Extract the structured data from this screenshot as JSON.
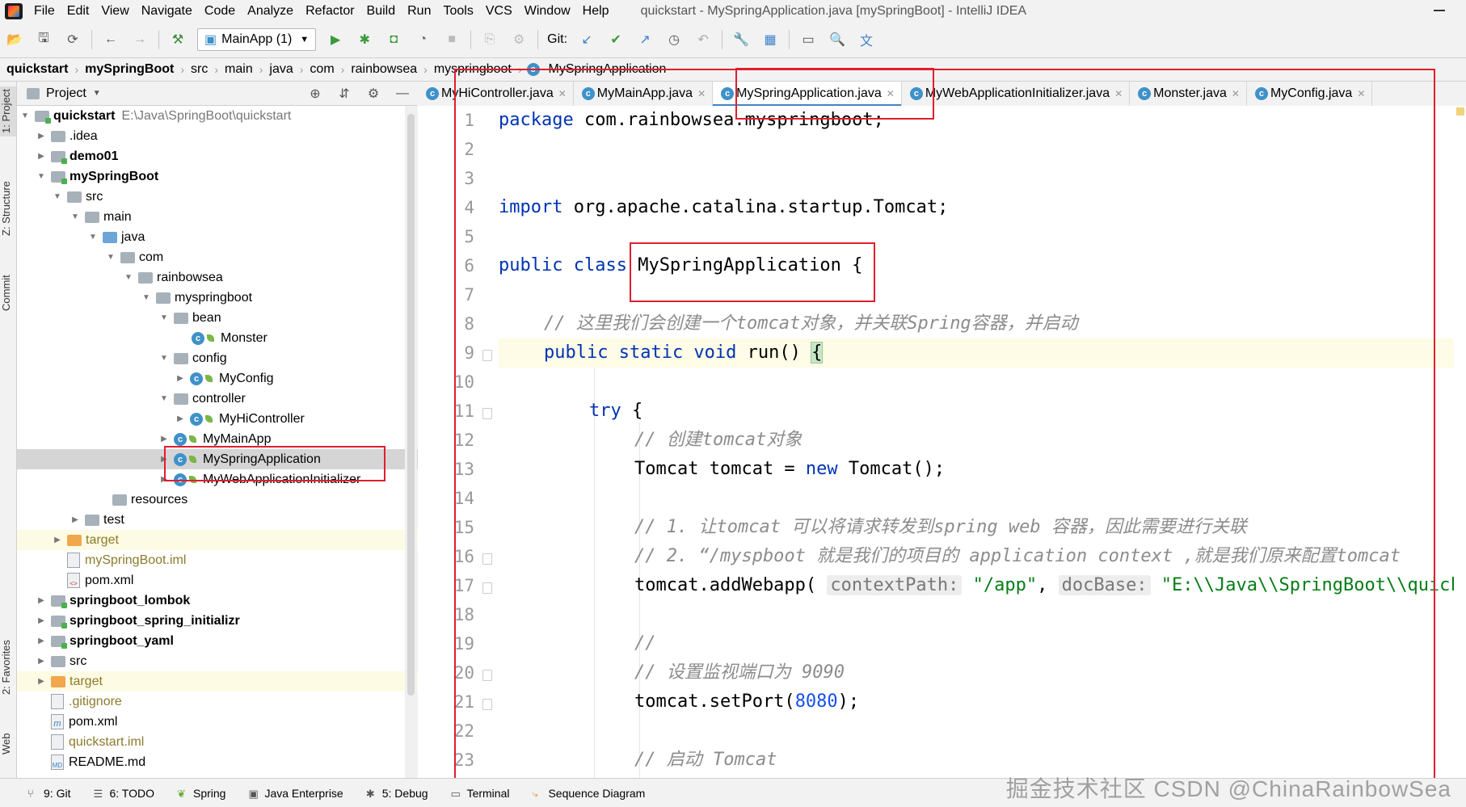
{
  "menu": {
    "items": [
      "File",
      "Edit",
      "View",
      "Navigate",
      "Code",
      "Analyze",
      "Refactor",
      "Build",
      "Run",
      "Tools",
      "VCS",
      "Window",
      "Help"
    ],
    "window_title": "quickstart - MySpringApplication.java [mySpringBoot] - IntelliJ IDEA"
  },
  "toolbar": {
    "run_config": "MainApp (1)",
    "git_label": "Git:"
  },
  "breadcrumb": [
    "quickstart",
    "mySpringBoot",
    "src",
    "main",
    "java",
    "com",
    "rainbowsea",
    "myspringboot",
    "MySpringApplication"
  ],
  "project_panel": {
    "title": "Project",
    "tree": [
      {
        "label": "quickstart",
        "path": "E:\\Java\\SpringBoot\\quickstart"
      },
      {
        "label": ".idea"
      },
      {
        "label": "demo01"
      },
      {
        "label": "mySpringBoot"
      },
      {
        "label": "src"
      },
      {
        "label": "main"
      },
      {
        "label": "java"
      },
      {
        "label": "com"
      },
      {
        "label": "rainbowsea"
      },
      {
        "label": "myspringboot"
      },
      {
        "label": "bean"
      },
      {
        "label": "Monster"
      },
      {
        "label": "config"
      },
      {
        "label": "MyConfig"
      },
      {
        "label": "controller"
      },
      {
        "label": "MyHiController"
      },
      {
        "label": "MyMainApp"
      },
      {
        "label": "MySpringApplication"
      },
      {
        "label": "MyWebApplicationInitializer"
      },
      {
        "label": "resources"
      },
      {
        "label": "test"
      },
      {
        "label": "target"
      },
      {
        "label": "mySpringBoot.iml"
      },
      {
        "label": "pom.xml"
      },
      {
        "label": "springboot_lombok"
      },
      {
        "label": "springboot_spring_initializr"
      },
      {
        "label": "springboot_yaml"
      },
      {
        "label": "src"
      },
      {
        "label": "target"
      },
      {
        "label": ".gitignore"
      },
      {
        "label": "pom.xml"
      },
      {
        "label": "quickstart.iml"
      },
      {
        "label": "README.md"
      }
    ]
  },
  "left_stripe": [
    "1: Project",
    "Z: Structure",
    "Commit",
    "2: Favorites",
    "Web"
  ],
  "editor_tabs": [
    "MyHiController.java",
    "MyMainApp.java",
    "MySpringApplication.java",
    "MyWebApplicationInitializer.java",
    "Monster.java",
    "MyConfig.java"
  ],
  "editor": {
    "line_numbers": [
      "1",
      "2",
      "3",
      "4",
      "5",
      "6",
      "7",
      "8",
      "9",
      "10",
      "11",
      "12",
      "13",
      "14",
      "15",
      "16",
      "17",
      "18",
      "19",
      "20",
      "21",
      "22",
      "23"
    ],
    "code": {
      "l1_kw": "package",
      "l1_rest": " com.rainbowsea.myspringboot;",
      "l4_kw": "import",
      "l4_rest": " org.apache.catalina.startup.Tomcat;",
      "l6_kw": "public class",
      "l6_name": " MySpringApplication ",
      "l6_brace": "{",
      "l8_comment": "// 这里我们会创建一个tomcat对象，并关联Spring容器，并启动",
      "l9_kw": "public static void",
      "l9_rest": " run() ",
      "l9_brace": "{",
      "l11_kw": "try",
      "l11_rest": " {",
      "l12_comment": "// 创建tomcat对象",
      "l13_a": "Tomcat tomcat = ",
      "l13_kw": "new",
      "l13_b": " Tomcat();",
      "l15_comment": "// 1. 让tomcat 可以将请求转发到spring web 容器，因此需要进行关联",
      "l16_comment": "// 2. “/myspboot 就是我们的项目的 application context ,就是我们原来配置tomcat",
      "l17_a": "tomcat.addWebapp( ",
      "l17_hint1": "contextPath:",
      "l17_str1": " \"/app\"",
      "l17_comma": ", ",
      "l17_hint2": "docBase:",
      "l17_str2": " \"E:\\\\Java\\\\SpringBoot\\\\quickst",
      "l19_comment": "//",
      "l20_comment": "// 设置监视端口为 9090",
      "l21_a": "tomcat.setPort(",
      "l21_num": "8080",
      "l21_b": ");",
      "l23_comment": "// 启动 Tomcat"
    }
  },
  "bottom_tools": [
    "9: Git",
    "6: TODO",
    "Spring",
    "Java Enterprise",
    "5: Debug",
    "Terminal",
    "Sequence Diagram"
  ],
  "watermark": "CSDN @ChinaRainbowSea",
  "watermark2": "掘金技术社区"
}
